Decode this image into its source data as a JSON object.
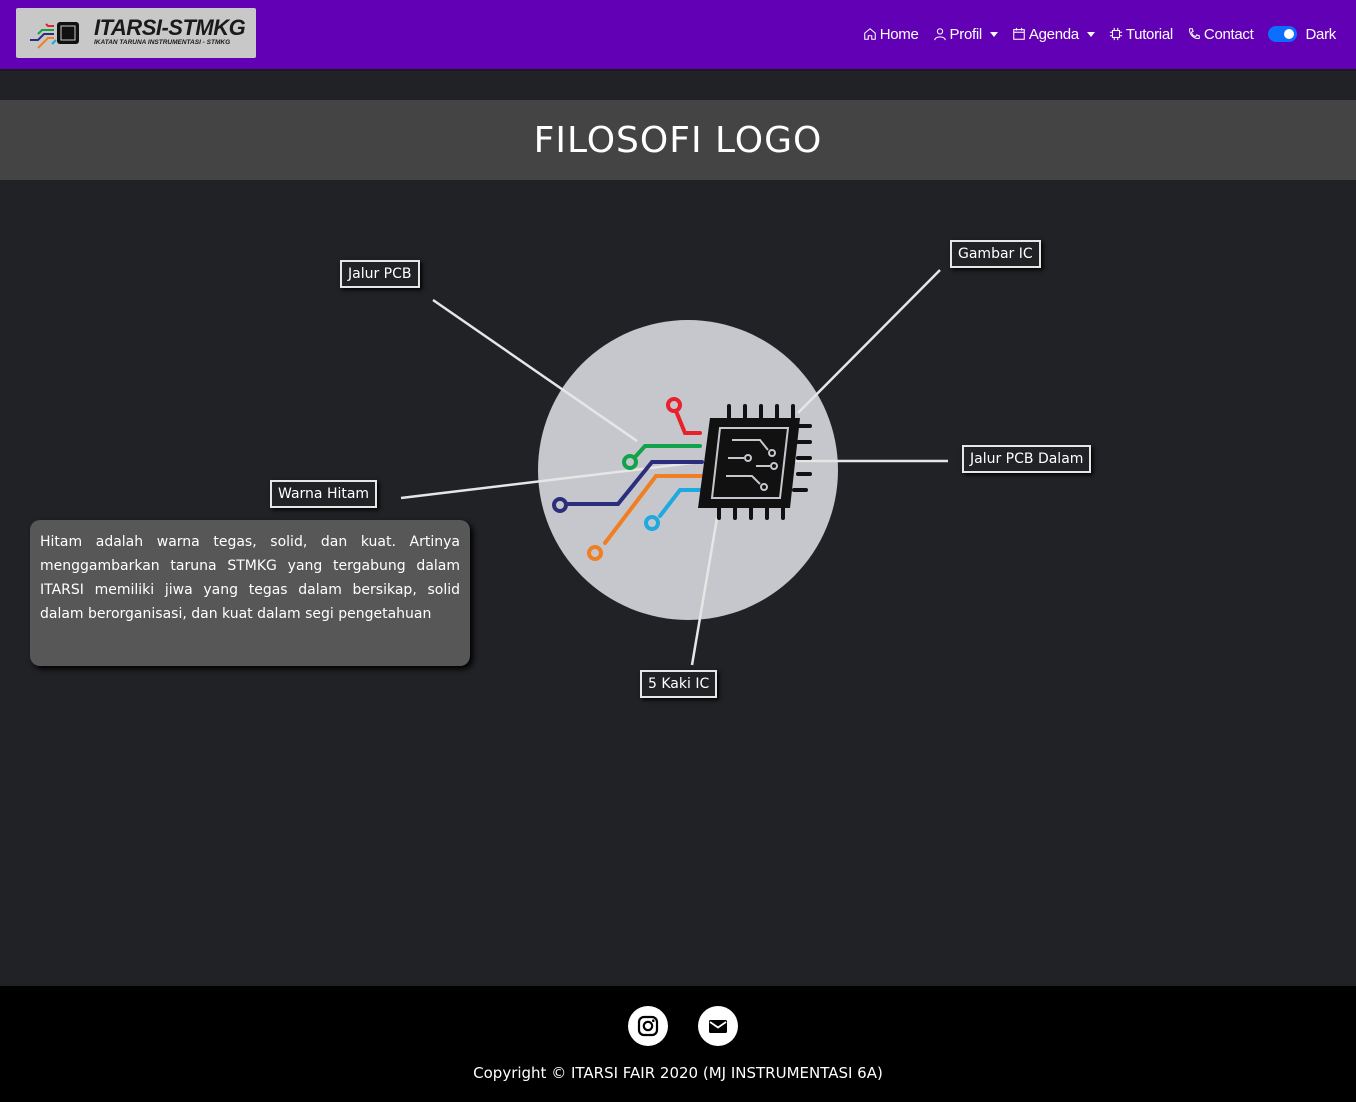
{
  "navbar": {
    "brand_title": "ITARSI-STMKG",
    "brand_subtitle": "IKATAN TARUNA INSTRUMENTASI - STMKG",
    "items": [
      {
        "label": "Home",
        "icon": "home-icon"
      },
      {
        "label": "Profil",
        "icon": "person-icon",
        "dropdown": true
      },
      {
        "label": "Agenda",
        "icon": "calendar-icon",
        "dropdown": true
      },
      {
        "label": "Tutorial",
        "icon": "cpu-icon"
      },
      {
        "label": "Contact",
        "icon": "phone-icon"
      }
    ],
    "theme_toggle_label": "Dark",
    "theme_toggle_on": true
  },
  "page": {
    "title": "FILOSOFI LOGO"
  },
  "diagram": {
    "labels": {
      "jalur_pcb": "Jalur PCB",
      "gambar_ic": "Gambar IC",
      "jalur_pcb_dalam": "Jalur PCB Dalam",
      "warna_hitam": "Warna Hitam",
      "kaki_ic": "5 Kaki IC"
    },
    "description": "Hitam adalah warna tegas, solid, dan kuat. Artinya menggambarkan taruna STMKG yang tergabung dalam ITARSI memiliki jiwa yang tegas dalam bersikap, solid dalam berorganisasi, dan kuat dalam segi pengetahuan"
  },
  "colors": {
    "navbar": "#6100b5",
    "background": "#212226",
    "band": "#444444",
    "circle": "#c5c7cc",
    "trace_red": "#e8212b",
    "trace_green": "#12a24a",
    "trace_navy": "#2b2e7a",
    "trace_orange": "#f07f23",
    "trace_cyan": "#1fa9e1"
  },
  "footer": {
    "icons": [
      "instagram-icon",
      "mail-icon"
    ],
    "copyright": "Copyright © ITARSI FAIR 2020 (MJ INSTRUMENTASI 6A)"
  }
}
